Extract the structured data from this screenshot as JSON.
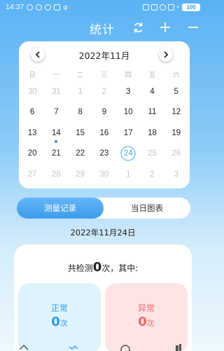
{
  "status_bar": {
    "time": "14:37",
    "battery": "100"
  },
  "app_bar": {
    "title": "统计",
    "icons": [
      "refresh-icon",
      "plus-icon",
      "minus-icon"
    ],
    "text_color": "#ffffff"
  },
  "calendar": {
    "title": "2022年11月",
    "weekdays": [
      "日",
      "一",
      "二",
      "三",
      "四",
      "五",
      "六"
    ],
    "weeks": [
      [
        "30",
        "31",
        "1",
        "2",
        "3",
        "4",
        "5"
      ],
      [
        "6",
        "7",
        "8",
        "9",
        "10",
        "11",
        "12"
      ],
      [
        "13",
        "14",
        "15",
        "16",
        "17",
        "18",
        "19"
      ],
      [
        "20",
        "21",
        "22",
        "23",
        "24",
        "25",
        "26"
      ],
      [
        "27",
        "28",
        "29",
        "30",
        "1",
        "2",
        "3"
      ]
    ],
    "selected_date": "24",
    "accent_color": "#3fa7ef"
  },
  "tabs": {
    "record": "测量记录",
    "daily_chart": "当日图表",
    "active": "record"
  },
  "selected_date_label": "2022年11月24日",
  "summary": {
    "prefix": "共检测",
    "count": "0",
    "suffix": "次，其中:"
  },
  "cards": {
    "normal": {
      "label": "正常",
      "count": "0",
      "unit": "次",
      "color": "#2e9ae6"
    },
    "abnormal": {
      "label": "异常",
      "count": "0",
      "unit": "次",
      "color": "#e96b6b"
    }
  }
}
